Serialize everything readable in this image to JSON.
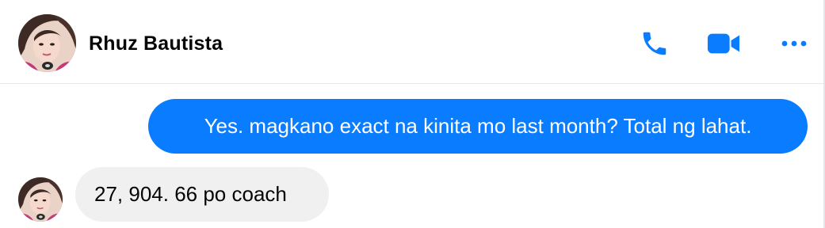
{
  "header": {
    "contact_name": "Rhuz Bautista",
    "avatar_icon": "profile-photo",
    "actions": [
      {
        "name": "phone-call",
        "icon": "phone-icon"
      },
      {
        "name": "video-call",
        "icon": "video-camera-icon"
      },
      {
        "name": "more-options",
        "icon": "more-horizontal-icon"
      }
    ]
  },
  "messages": [
    {
      "direction": "outgoing",
      "text": "Yes. magkano exact na kinita mo last month? Total ng lahat."
    },
    {
      "direction": "incoming",
      "text": "27, 904. 66 po coach"
    }
  ],
  "colors": {
    "accent": "#0a7cff",
    "incoming_bubble": "#f0f0f0",
    "text": "#050505"
  }
}
